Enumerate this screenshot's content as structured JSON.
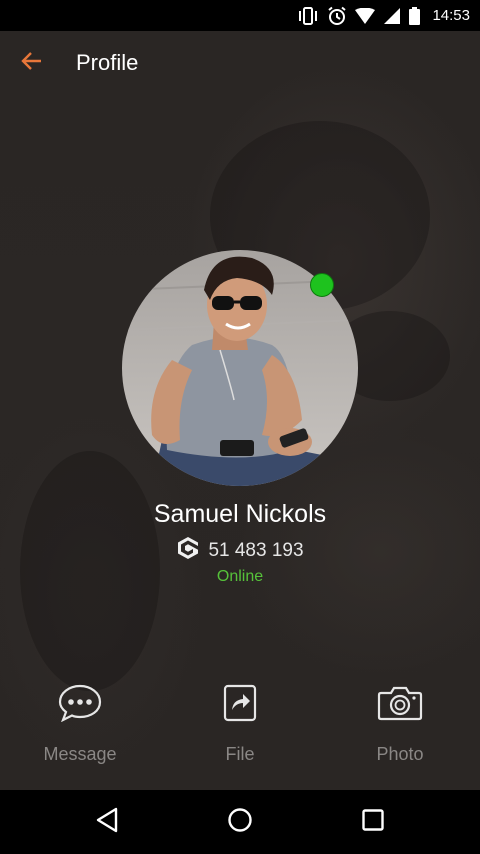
{
  "status_bar": {
    "time": "14:53",
    "icons": [
      "vibrate-icon",
      "alarm-icon",
      "wifi-icon",
      "signal-icon",
      "battery-icon"
    ]
  },
  "app_bar": {
    "title": "Profile",
    "back_icon": "arrow-left-icon",
    "accent_color": "#e8773a"
  },
  "profile": {
    "name": "Samuel Nickols",
    "id_number": "51 483 193",
    "id_icon": "app-logo-icon",
    "status": "Online",
    "status_color": "#56c23a",
    "presence_dot_color": "#1ec21e"
  },
  "actions": [
    {
      "label": "Message",
      "icon": "chat-bubble-icon"
    },
    {
      "label": "File",
      "icon": "share-file-icon"
    },
    {
      "label": "Photo",
      "icon": "camera-icon"
    }
  ],
  "nav_bar": {
    "buttons": [
      "back-triangle-icon",
      "home-circle-icon",
      "recents-square-icon"
    ]
  }
}
